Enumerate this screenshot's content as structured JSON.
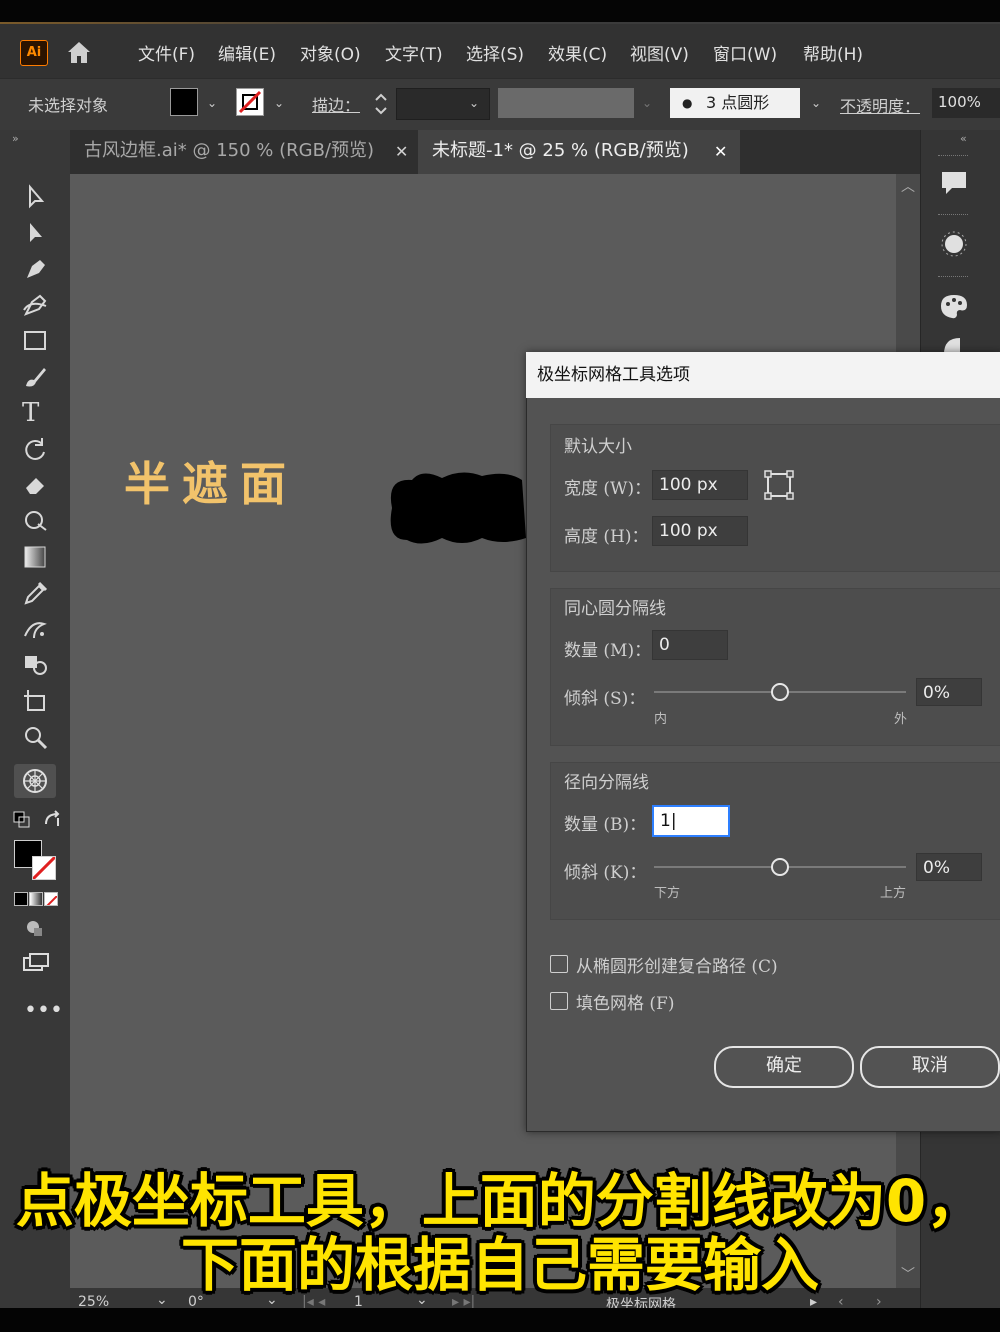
{
  "app": {
    "logo": "Ai"
  },
  "menu": [
    "文件(F)",
    "编辑(E)",
    "对象(O)",
    "文字(T)",
    "选择(S)",
    "效果(C)",
    "视图(V)",
    "窗口(W)",
    "帮助(H)"
  ],
  "control_bar": {
    "selection_status": "未选择对象",
    "stroke_label": "描边：",
    "brush_label": "3 点圆形",
    "opacity_label": "不透明度：",
    "opacity_value": "100%"
  },
  "tabs": [
    {
      "label": "古风边框.ai* @ 150 % (RGB/预览)",
      "active": false
    },
    {
      "label": "未标题-1* @ 25 % (RGB/预览)",
      "active": true
    }
  ],
  "canvas": {
    "art_text": "半遮面"
  },
  "dialog": {
    "title": "极坐标网格工具选项",
    "default_size": {
      "heading": "默认大小",
      "width_label": "宽度 (W)：",
      "width_value": "100 px",
      "height_label": "高度 (H)：",
      "height_value": "100 px"
    },
    "concentric": {
      "heading": "同心圆分隔线",
      "count_label": "数量 (M)：",
      "count_value": "0",
      "skew_label": "倾斜 (S)：",
      "skew_value": "0%",
      "left_label": "内",
      "right_label": "外",
      "skew_position": 0.5
    },
    "radial": {
      "heading": "径向分隔线",
      "count_label": "数量 (B)：",
      "count_value": "1",
      "skew_label": "倾斜 (K)：",
      "skew_value": "0%",
      "left_label": "下方",
      "right_label": "上方",
      "skew_position": 0.5
    },
    "checkbox_compound": "从椭圆形创建复合路径 (C)",
    "checkbox_fill": "填色网格 (F)",
    "ok_label": "确定",
    "cancel_label": "取消"
  },
  "status_bar": {
    "zoom": "25%",
    "rotation": "0°",
    "artboard": "1",
    "tool_name": "极坐标网格"
  },
  "subtitles": {
    "line1": "点极坐标工具，上面的分割线改为0，",
    "line2": "下面的根据自己需要输入"
  },
  "colors": {
    "accent_orange": "#ff7c00",
    "art_gold": "#f2c36b",
    "subtitle_yellow": "#ffe400",
    "focus_blue": "#2d7fff"
  }
}
